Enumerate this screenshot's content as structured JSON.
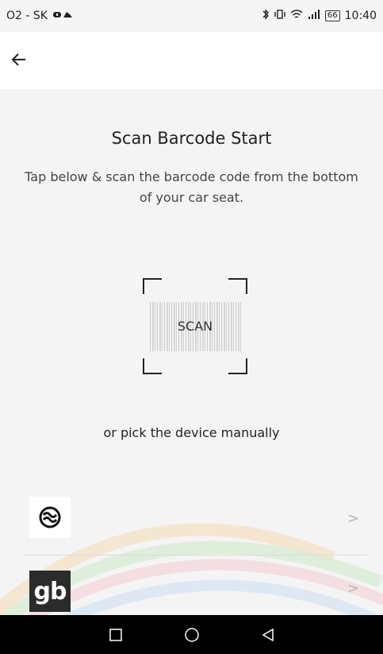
{
  "status_bar": {
    "carrier": "O2 - SK",
    "battery": "66",
    "time": "10:40"
  },
  "app_bar": {
    "back_icon": "arrow-left-icon"
  },
  "content": {
    "title": "Scan Barcode Start",
    "subtitle": "Tap below & scan the barcode code from the bottom of your car seat.",
    "scan_label": "SCAN",
    "or_pick_label": "or pick the device manually",
    "devices": [
      {
        "logo_icon": "brand-swirl-icon",
        "chevron": ">"
      },
      {
        "logo_text": "gb",
        "chevron": ">"
      }
    ]
  },
  "nav_bar": {
    "buttons": [
      "recents-square-icon",
      "home-circle-icon",
      "back-triangle-icon"
    ]
  },
  "colors": {
    "background": "#f4f4f4",
    "nav_bar": "#000000",
    "text": "#222222"
  }
}
